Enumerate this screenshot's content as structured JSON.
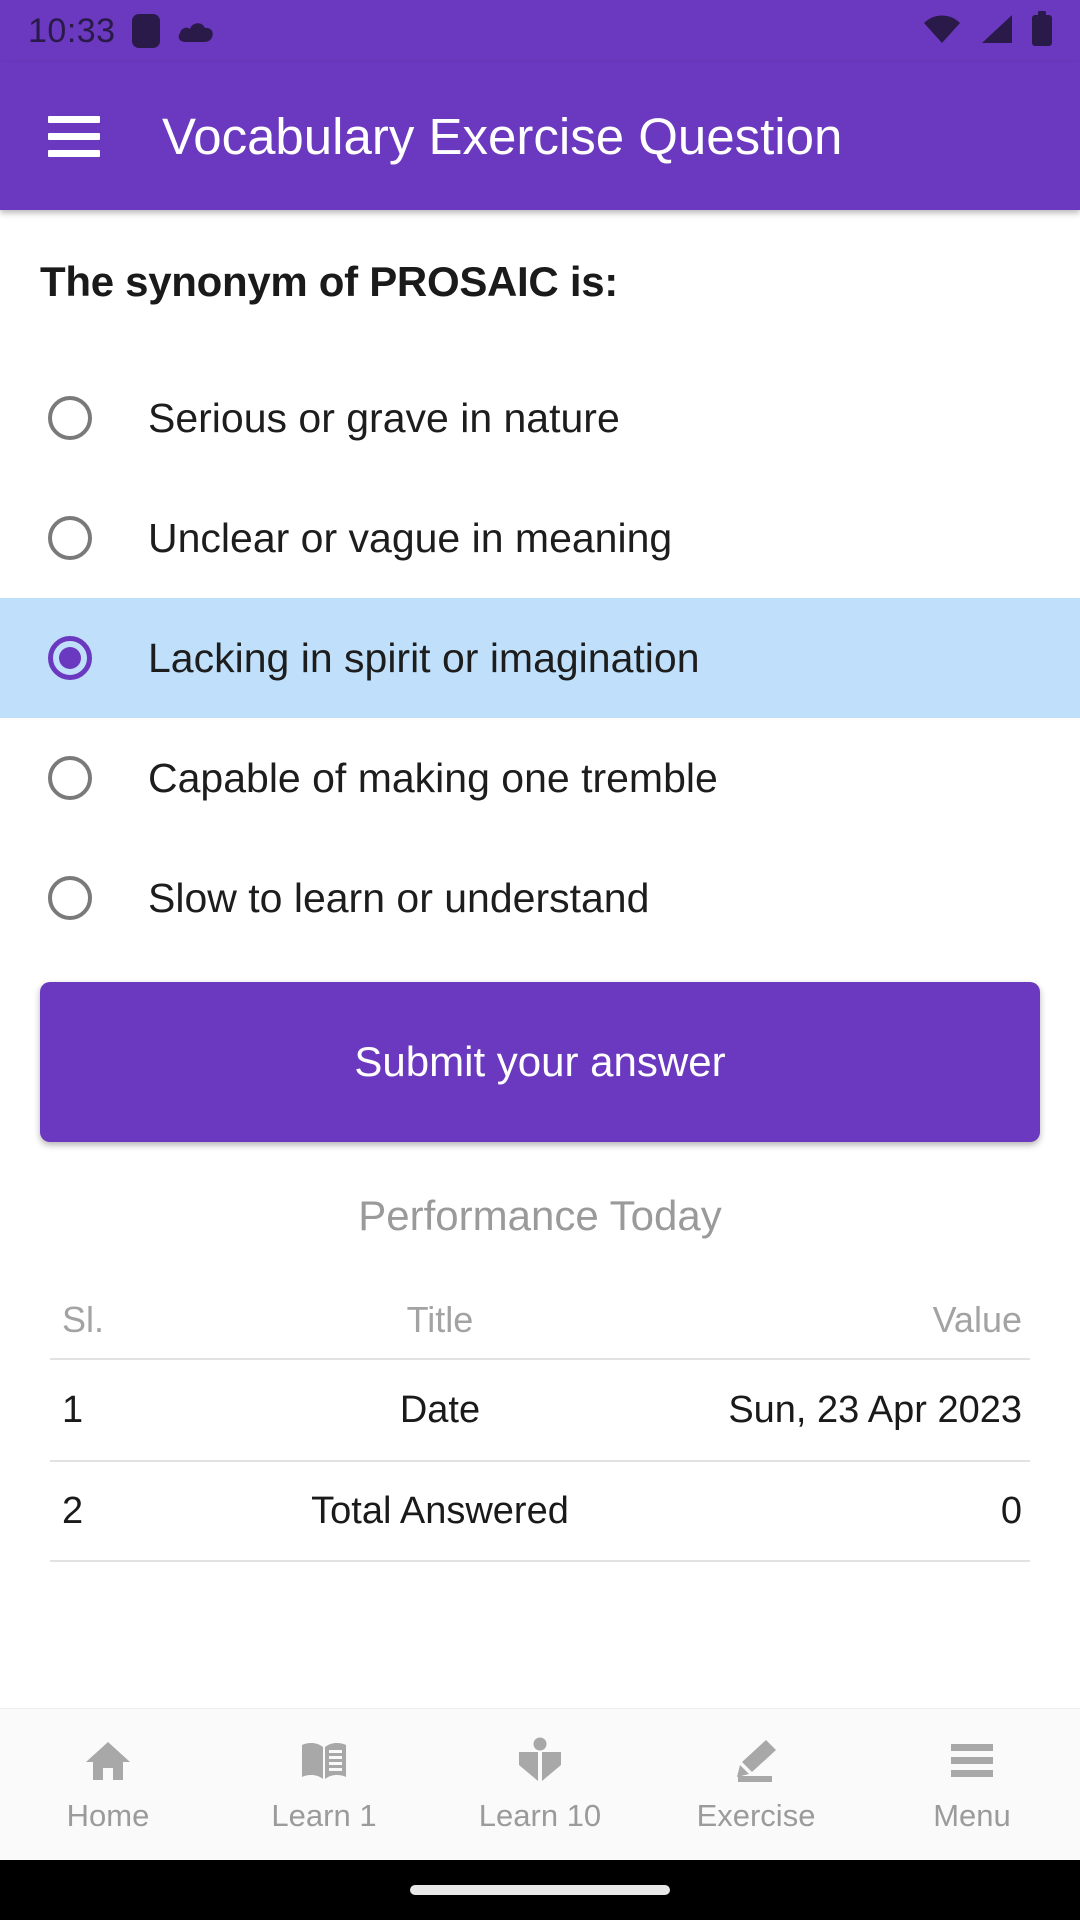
{
  "statusbar": {
    "time": "10:33",
    "icons_left": [
      "app-square-icon",
      "cloud-icon"
    ],
    "icons_right": [
      "wifi-icon",
      "cellular-signal-icon",
      "battery-icon"
    ]
  },
  "appbar": {
    "menu_icon": "hamburger-menu-icon",
    "title": "Vocabulary Exercise Question",
    "background_color": "#6B39BF",
    "text_color": "#FFFFFF"
  },
  "question": {
    "text": "The synonym of PROSAIC is:"
  },
  "options": [
    {
      "id": 1,
      "label": "Serious or grave in nature",
      "selected": false
    },
    {
      "id": 2,
      "label": "Unclear or vague in meaning",
      "selected": false
    },
    {
      "id": 3,
      "label": "Lacking in spirit or imagination",
      "selected": true
    },
    {
      "id": 4,
      "label": "Capable of making one tremble",
      "selected": false
    },
    {
      "id": 5,
      "label": "Slow to learn or understand",
      "selected": false
    }
  ],
  "selection": {
    "highlight_color": "#BFDFFB",
    "radio_color": "#6B39BF"
  },
  "submit": {
    "label": "Submit your answer"
  },
  "performance": {
    "title": "Performance Today",
    "columns": [
      "Sl.",
      "Title",
      "Value"
    ],
    "rows": [
      {
        "sl": "1",
        "title": "Date",
        "value": "Sun, 23 Apr 2023"
      },
      {
        "sl": "2",
        "title": "Total Answered",
        "value": "0"
      }
    ]
  },
  "bottomnav": {
    "items": [
      {
        "label": "Home",
        "icon": "home-icon"
      },
      {
        "label": "Learn 1",
        "icon": "open-book-icon"
      },
      {
        "label": "Learn 10",
        "icon": "person-reading-icon"
      },
      {
        "label": "Exercise",
        "icon": "pencil-edit-icon"
      },
      {
        "label": "Menu",
        "icon": "hamburger-menu-icon"
      }
    ]
  }
}
